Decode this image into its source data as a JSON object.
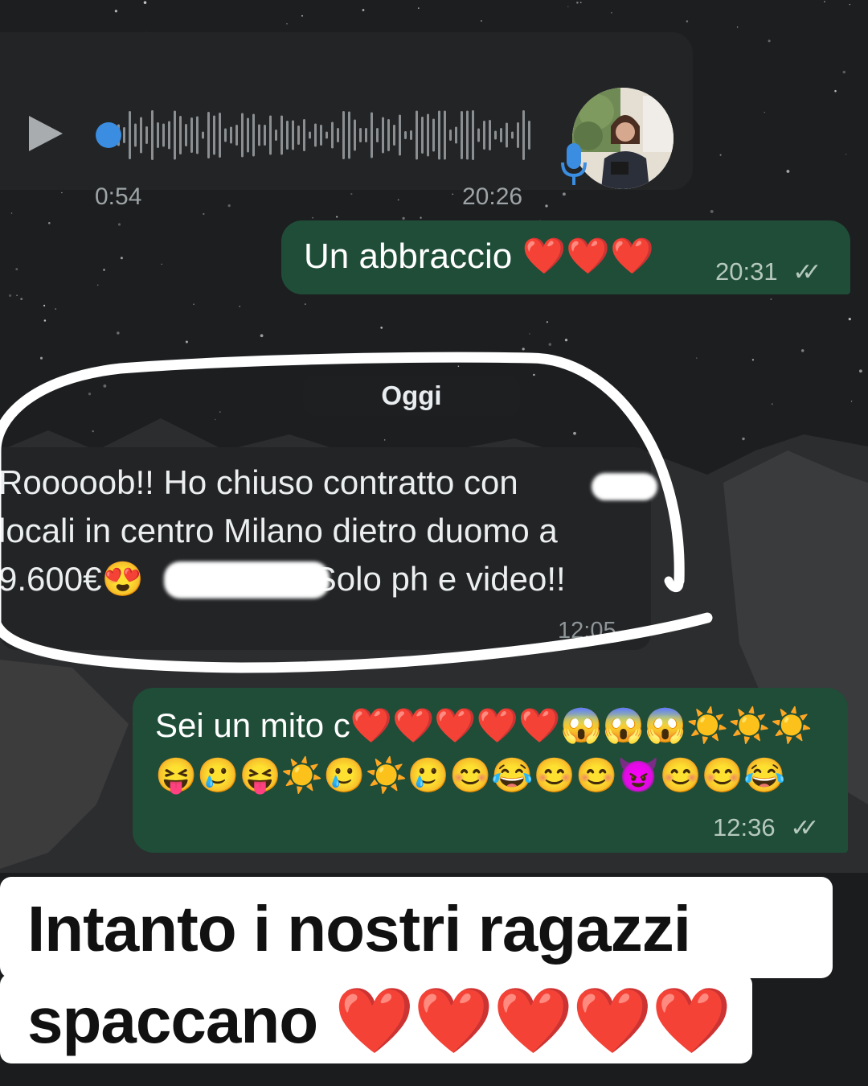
{
  "voice_message": {
    "duration": "0:54",
    "time": "20:26"
  },
  "outgoing_1": {
    "text": "Un abbraccio ❤️❤️❤️",
    "time": "20:31",
    "status_icon": "double-check-icon"
  },
  "date_chip": {
    "label": "Oggi"
  },
  "incoming_message": {
    "line1": "Rooooob!! Ho chiuso contratto con",
    "line2": "locali in centro Milano dietro duomo a",
    "line3_amount": "9.600€😍",
    "line3_tail": "Solo ph e video!!",
    "time": "12:05"
  },
  "outgoing_2": {
    "text": "Sei un mito c❤️❤️❤️❤️❤️😱😱😱☀️☀️☀️😝🥲😝☀️🥲☀️🥲😊😂😊😊😈😊😊😂",
    "time": "12:36",
    "status_icon": "double-check-icon"
  },
  "caption": {
    "line1": "Intanto i nostri ragazzi",
    "line2": "spaccano ❤️❤️❤️❤️❤️"
  },
  "colors": {
    "outgoing_bubble": "#1f4d38",
    "incoming_bubble": "#222426",
    "voice_dot": "#3a8de0",
    "caption_bg": "#ffffff"
  }
}
